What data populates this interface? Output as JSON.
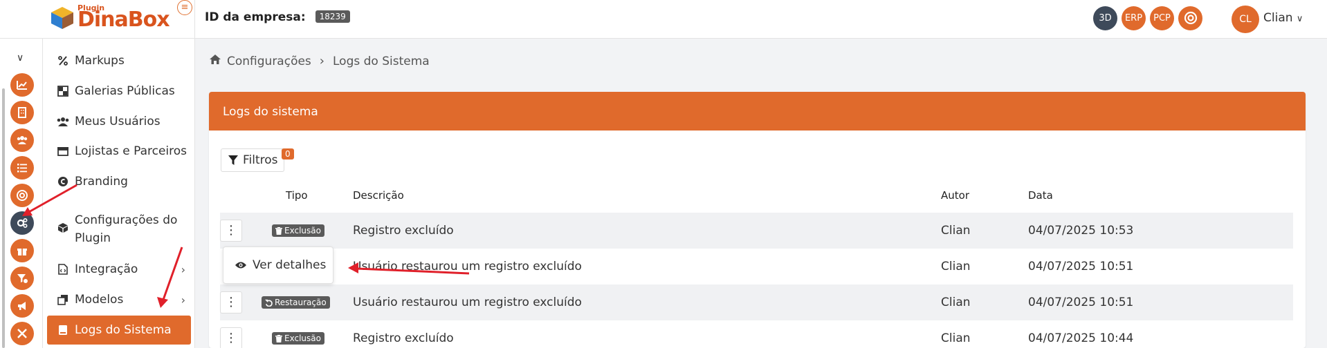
{
  "header": {
    "logo_small": "Plugin",
    "logo_text": "DinaBox",
    "company_label": "ID da empresa:",
    "company_id": "18239",
    "badges": [
      "3D",
      "ERP",
      "PCP"
    ],
    "user_initials": "CL",
    "user_name": "Clian"
  },
  "rail": {
    "icons": [
      "chart-icon",
      "building-icon",
      "users-icon",
      "list-icon",
      "support-icon",
      "gears-icon",
      "gift-icon",
      "filter-icon",
      "megaphone-icon",
      "tools-icon"
    ],
    "active_index": 5
  },
  "menu": {
    "items": [
      {
        "label": "Markups",
        "icon": "percent-icon"
      },
      {
        "label": "Galerias Públicas",
        "icon": "gallery-icon"
      },
      {
        "label": "Meus Usuários",
        "icon": "users-icon"
      },
      {
        "label": "Lojistas e Parceiros",
        "icon": "store-icon"
      },
      {
        "label": "Branding",
        "icon": "copyright-icon"
      },
      {
        "label": "Configurações do Plugin",
        "icon": "box-icon"
      },
      {
        "label": "Integração",
        "icon": "file-code-icon"
      },
      {
        "label": "Modelos",
        "icon": "clone-icon"
      },
      {
        "label": "Logs do Sistema",
        "icon": "book-icon"
      }
    ]
  },
  "breadcrumb": {
    "parent": "Configurações",
    "current": "Logs do Sistema"
  },
  "card": {
    "title": "Logs do sistema",
    "filters_label": "Filtros",
    "filters_count": "0"
  },
  "table": {
    "columns": [
      "Tipo",
      "Descrição",
      "Autor",
      "Data"
    ],
    "rows": [
      {
        "type": "Exclusão",
        "description": "Registro excluído",
        "author": "Clian",
        "date": "04/07/2025 10:53"
      },
      {
        "type": "",
        "description": "Usuário restaurou um registro excluído",
        "author": "Clian",
        "date": "04/07/2025 10:51"
      },
      {
        "type": "Restauração",
        "description": "Usuário restaurou um registro excluído",
        "author": "Clian",
        "date": "04/07/2025 10:51"
      },
      {
        "type": "Exclusão",
        "description": "Registro excluído",
        "author": "Clian",
        "date": "04/07/2025 10:44"
      }
    ]
  },
  "popup": {
    "label": "Ver detalhes"
  },
  "colors": {
    "accent": "#e06a2c",
    "dark": "#3e4a5a",
    "annotation": "#e0202a"
  }
}
